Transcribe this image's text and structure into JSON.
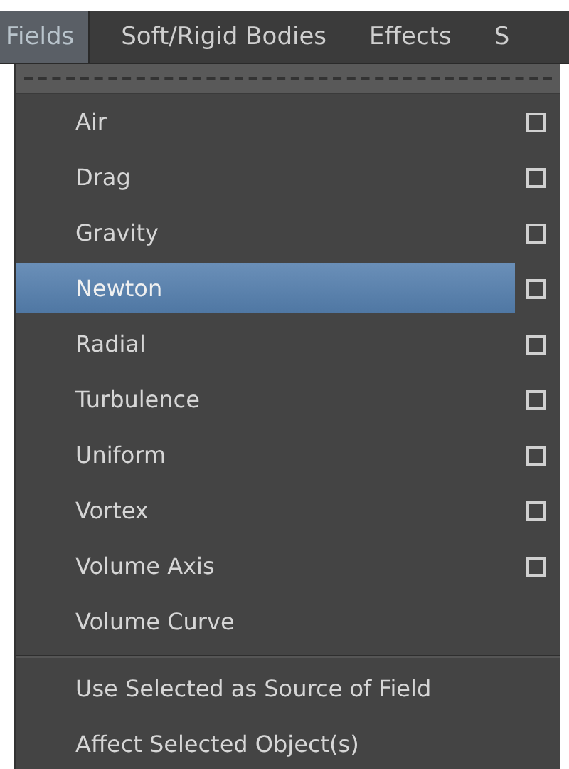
{
  "menu_bar": [
    {
      "label": "Fields",
      "selected": true
    },
    {
      "label": "Soft/Rigid Bodies",
      "selected": false
    },
    {
      "label": "Effects",
      "selected": false
    },
    {
      "label": "S",
      "selected": false
    }
  ],
  "menu": {
    "items": [
      {
        "kind": "option",
        "label": "Air",
        "selected": false
      },
      {
        "kind": "option",
        "label": "Drag",
        "selected": false
      },
      {
        "kind": "option",
        "label": "Gravity",
        "selected": false
      },
      {
        "kind": "option",
        "label": "Newton",
        "selected": true
      },
      {
        "kind": "option",
        "label": "Radial",
        "selected": false
      },
      {
        "kind": "option",
        "label": "Turbulence",
        "selected": false
      },
      {
        "kind": "option",
        "label": "Uniform",
        "selected": false
      },
      {
        "kind": "option",
        "label": "Vortex",
        "selected": false
      },
      {
        "kind": "option",
        "label": "Volume Axis",
        "selected": false
      },
      {
        "kind": "plain",
        "label": "Volume Curve",
        "selected": false
      },
      {
        "kind": "separator"
      },
      {
        "kind": "plain",
        "label": "Use Selected as Source of Field",
        "selected": false
      },
      {
        "kind": "plain",
        "label": "Affect Selected Object(s)",
        "selected": false
      }
    ]
  }
}
